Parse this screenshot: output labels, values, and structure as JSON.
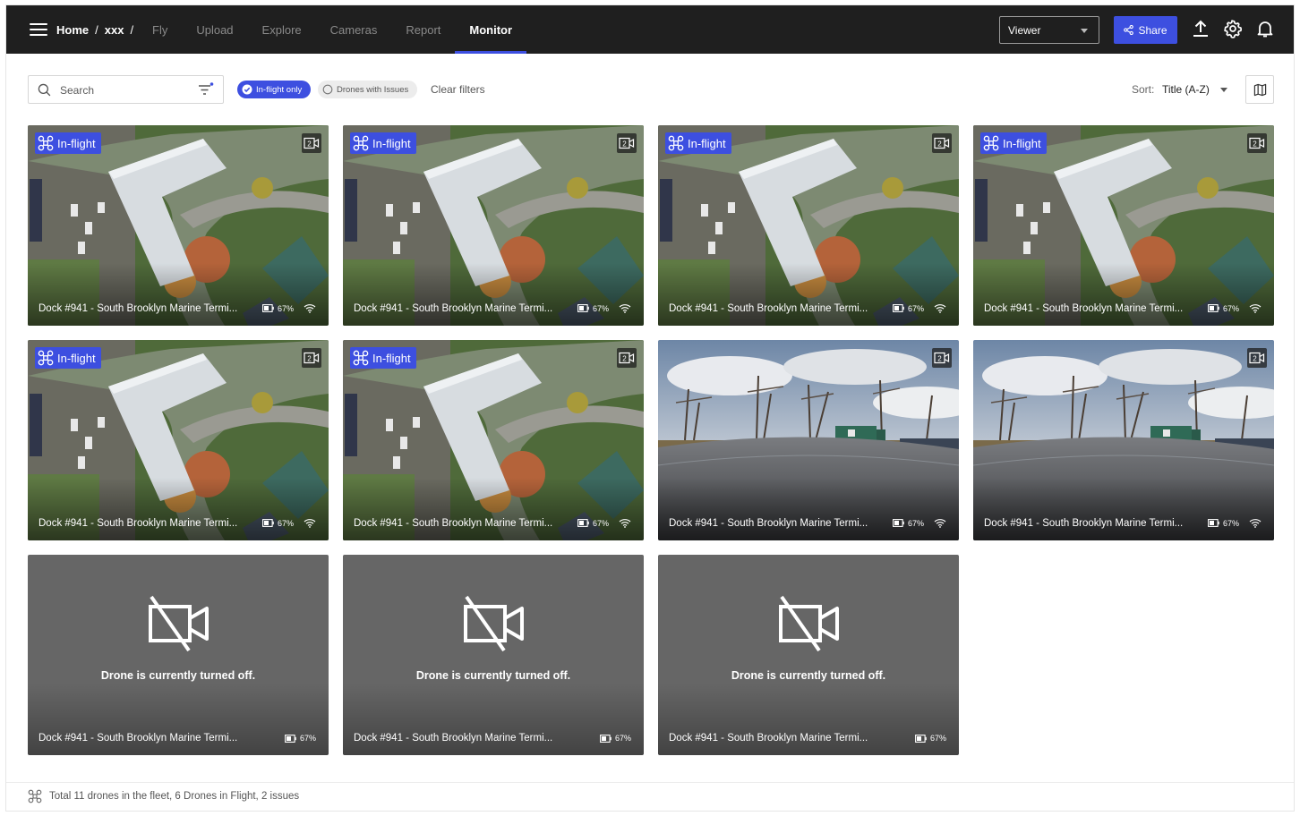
{
  "header": {
    "breadcrumbs": [
      "Home",
      "xxx"
    ],
    "breadcrumb_sep": "/",
    "tabs": [
      {
        "label": "Fly",
        "active": false
      },
      {
        "label": "Upload",
        "active": false
      },
      {
        "label": "Explore",
        "active": false
      },
      {
        "label": "Cameras",
        "active": false
      },
      {
        "label": "Report",
        "active": false
      },
      {
        "label": "Monitor",
        "active": true
      }
    ],
    "role_select": "Viewer",
    "share_label": "Share"
  },
  "toolbar": {
    "search_placeholder": "Search",
    "filters": [
      {
        "label": "In-flight only",
        "checked": true
      },
      {
        "label": "Drones with Issues",
        "checked": false
      }
    ],
    "clear_filters": "Clear filters",
    "sort_label": "Sort:",
    "sort_value": "Title (A-Z)"
  },
  "cards": [
    {
      "kind": "aerial",
      "in_flight": true,
      "badge": "In-flight",
      "title": "Dock #941 - South Brooklyn Marine Termi...",
      "battery": "67%"
    },
    {
      "kind": "aerial",
      "in_flight": true,
      "badge": "In-flight",
      "title": "Dock #941 - South Brooklyn Marine Termi...",
      "battery": "67%"
    },
    {
      "kind": "aerial",
      "in_flight": true,
      "badge": "In-flight",
      "title": "Dock #941 - South Brooklyn Marine Termi...",
      "battery": "67%"
    },
    {
      "kind": "aerial",
      "in_flight": true,
      "badge": "In-flight",
      "title": "Dock #941 - South Brooklyn Marine Termi...",
      "battery": "67%"
    },
    {
      "kind": "aerial",
      "in_flight": true,
      "badge": "In-flight",
      "title": "Dock #941 - South Brooklyn Marine Termi...",
      "battery": "67%"
    },
    {
      "kind": "aerial",
      "in_flight": true,
      "badge": "In-flight",
      "title": "Dock #941 - South Brooklyn Marine Termi...",
      "battery": "67%"
    },
    {
      "kind": "ground",
      "in_flight": false,
      "title": "Dock #941 - South Brooklyn Marine Termi...",
      "battery": "67%"
    },
    {
      "kind": "ground",
      "in_flight": false,
      "title": "Dock #941 - South Brooklyn Marine Termi...",
      "battery": "67%"
    },
    {
      "kind": "off",
      "message": "Drone is currently turned off.",
      "title": "Dock #941 - South Brooklyn Marine Termi...",
      "battery": "67%"
    },
    {
      "kind": "off",
      "message": "Drone is currently turned off.",
      "title": "Dock #941 - South Brooklyn Marine Termi...",
      "battery": "67%"
    },
    {
      "kind": "off",
      "message": "Drone is currently turned off.",
      "title": "Dock #941 - South Brooklyn Marine Termi...",
      "battery": "67%"
    }
  ],
  "footer": {
    "summary": "Total 11 drones in the fleet, 6 Drones in Flight, 2 issues"
  },
  "colors": {
    "topbar": "#1f1f1f",
    "accent": "#3d4fe0",
    "offline_card": "#666666"
  }
}
